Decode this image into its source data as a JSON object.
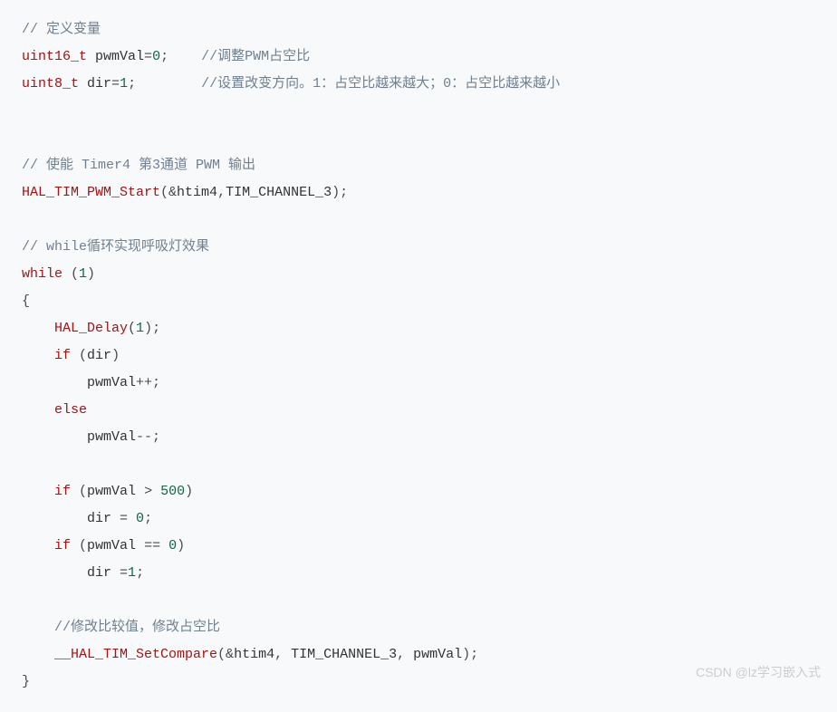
{
  "code": {
    "l1_comment": "// 定义变量",
    "l2_type": "uint16_t",
    "l2_var": "pwmVal",
    "l2_eq": "=",
    "l2_val": "0",
    "l2_semi": ";",
    "l2_comment": "//调整PWM占空比",
    "l3_type": "uint8_t",
    "l3_var": "dir",
    "l3_eq": "=",
    "l3_val": "1",
    "l3_semi": ";",
    "l3_comment": "//设置改变方向。1：占空比越来越大；0：占空比越来越小",
    "l6_comment": "// 使能 Timer4 第3通道 PWM 输出",
    "l7_func": "HAL_TIM_PWM_Start",
    "l7_open": "(&",
    "l7_arg1": "htim4",
    "l7_comma": ",",
    "l7_arg2": "TIM_CHANNEL_3",
    "l7_close": ");",
    "l9_comment": "// while循环实现呼吸灯效果",
    "l10_kw": "while",
    "l10_open": " (",
    "l10_val": "1",
    "l10_close": ")",
    "l11": "{",
    "l12_func": "HAL_Delay",
    "l12_open": "(",
    "l12_val": "1",
    "l12_close": ");",
    "l13_kw": "if",
    "l13_open": " (",
    "l13_var": "dir",
    "l13_close": ")",
    "l14_var": "pwmVal",
    "l14_op": "++;",
    "l15_kw": "else",
    "l16_var": "pwmVal",
    "l16_op": "--;",
    "l18_kw": "if",
    "l18_open": " (",
    "l18_var": "pwmVal",
    "l18_gt": " > ",
    "l18_val": "500",
    "l18_close": ")",
    "l19_var": "dir",
    "l19_eq": " = ",
    "l19_val": "0",
    "l19_semi": ";",
    "l20_kw": "if",
    "l20_open": " (",
    "l20_var": "pwmVal",
    "l20_eq": " == ",
    "l20_val": "0",
    "l20_close": ")",
    "l21_var": "dir",
    "l21_eq": " =",
    "l21_val": "1",
    "l21_semi": ";",
    "l23_comment": "//修改比较值，修改占空比",
    "l24_func": "__HAL_TIM_SetCompare",
    "l24_open": "(&",
    "l24_arg1": "htim4",
    "l24_c1": ", ",
    "l24_arg2": "TIM_CHANNEL_3",
    "l24_c2": ", ",
    "l24_arg3": "pwmVal",
    "l24_close": ");",
    "l25": "}"
  },
  "watermark": "CSDN @lz学习嵌入式"
}
